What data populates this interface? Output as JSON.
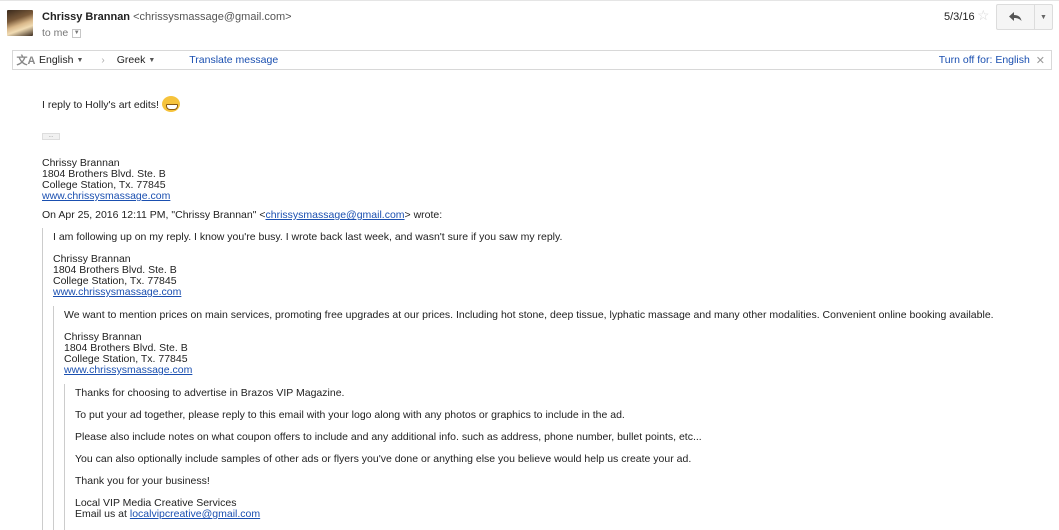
{
  "header": {
    "sender_name": "Chrissy Brannan",
    "sender_email": "<chrissysmassage@gmail.com>",
    "recipient": "to me",
    "date": "5/3/16"
  },
  "translate_bar": {
    "from_language": "English",
    "to_language": "Greek",
    "translate_link": "Translate message",
    "turn_off_label": "Turn off for: English"
  },
  "icons": {
    "translate": "translate-icon",
    "star": "star-icon",
    "reply": "reply-icon",
    "more": "chevron-down-icon",
    "close": "close-icon",
    "emoji": "grinning-face-emoji"
  },
  "message": {
    "body": "I reply to Holly's art edits!",
    "trimmed_content": "...",
    "signature": {
      "name": "Chrissy Brannan",
      "address1": "1804 Brothers Blvd. Ste. B",
      "address2": "College Station, Tx. 77845",
      "website": "www.chrissysmassage.com"
    },
    "quote_attribution_prefix": "On Apr 25, 2016 12:11 PM, \"Chrissy Brannan\" <",
    "quote_attribution_email": "chrissysmassage@gmail.com",
    "quote_attribution_suffix": "> wrote:"
  },
  "quote1": {
    "body": "I am following up on my reply. I know you're busy. I wrote back last week, and wasn't sure if you saw my reply.",
    "signature": {
      "name": "Chrissy Brannan",
      "address1": "1804 Brothers Blvd. Ste. B",
      "address2": "College Station, Tx. 77845",
      "website": "www.chrissysmassage.com"
    }
  },
  "quote2": {
    "body": "We want to mention prices on main services, promoting free upgrades at our prices. Including hot stone, deep tissue, lyphatic massage and many other modalities. Convenient online booking available.",
    "signature": {
      "name": "Chrissy Brannan",
      "address1": "1804 Brothers Blvd. Ste. B",
      "address2": "College Station, Tx. 77845",
      "website": "www.chrissysmassage.com"
    }
  },
  "quote3": {
    "paragraphs": [
      "Thanks for choosing to advertise in Brazos VIP Magazine.",
      "To put your ad together, please reply to this email with your logo along with any photos or graphics to include in the ad.",
      "Please also include notes on what coupon offers to include and any additional info. such as address, phone number, bullet points, etc...",
      "You can also optionally include samples of other ads or flyers you've done or anything else you believe would help us create your ad.",
      "Thank you for your business!"
    ],
    "sign_off": "Local VIP Media Creative Services",
    "email_prefix": "Email us at ",
    "email": "localvipcreative@gmail.com"
  }
}
